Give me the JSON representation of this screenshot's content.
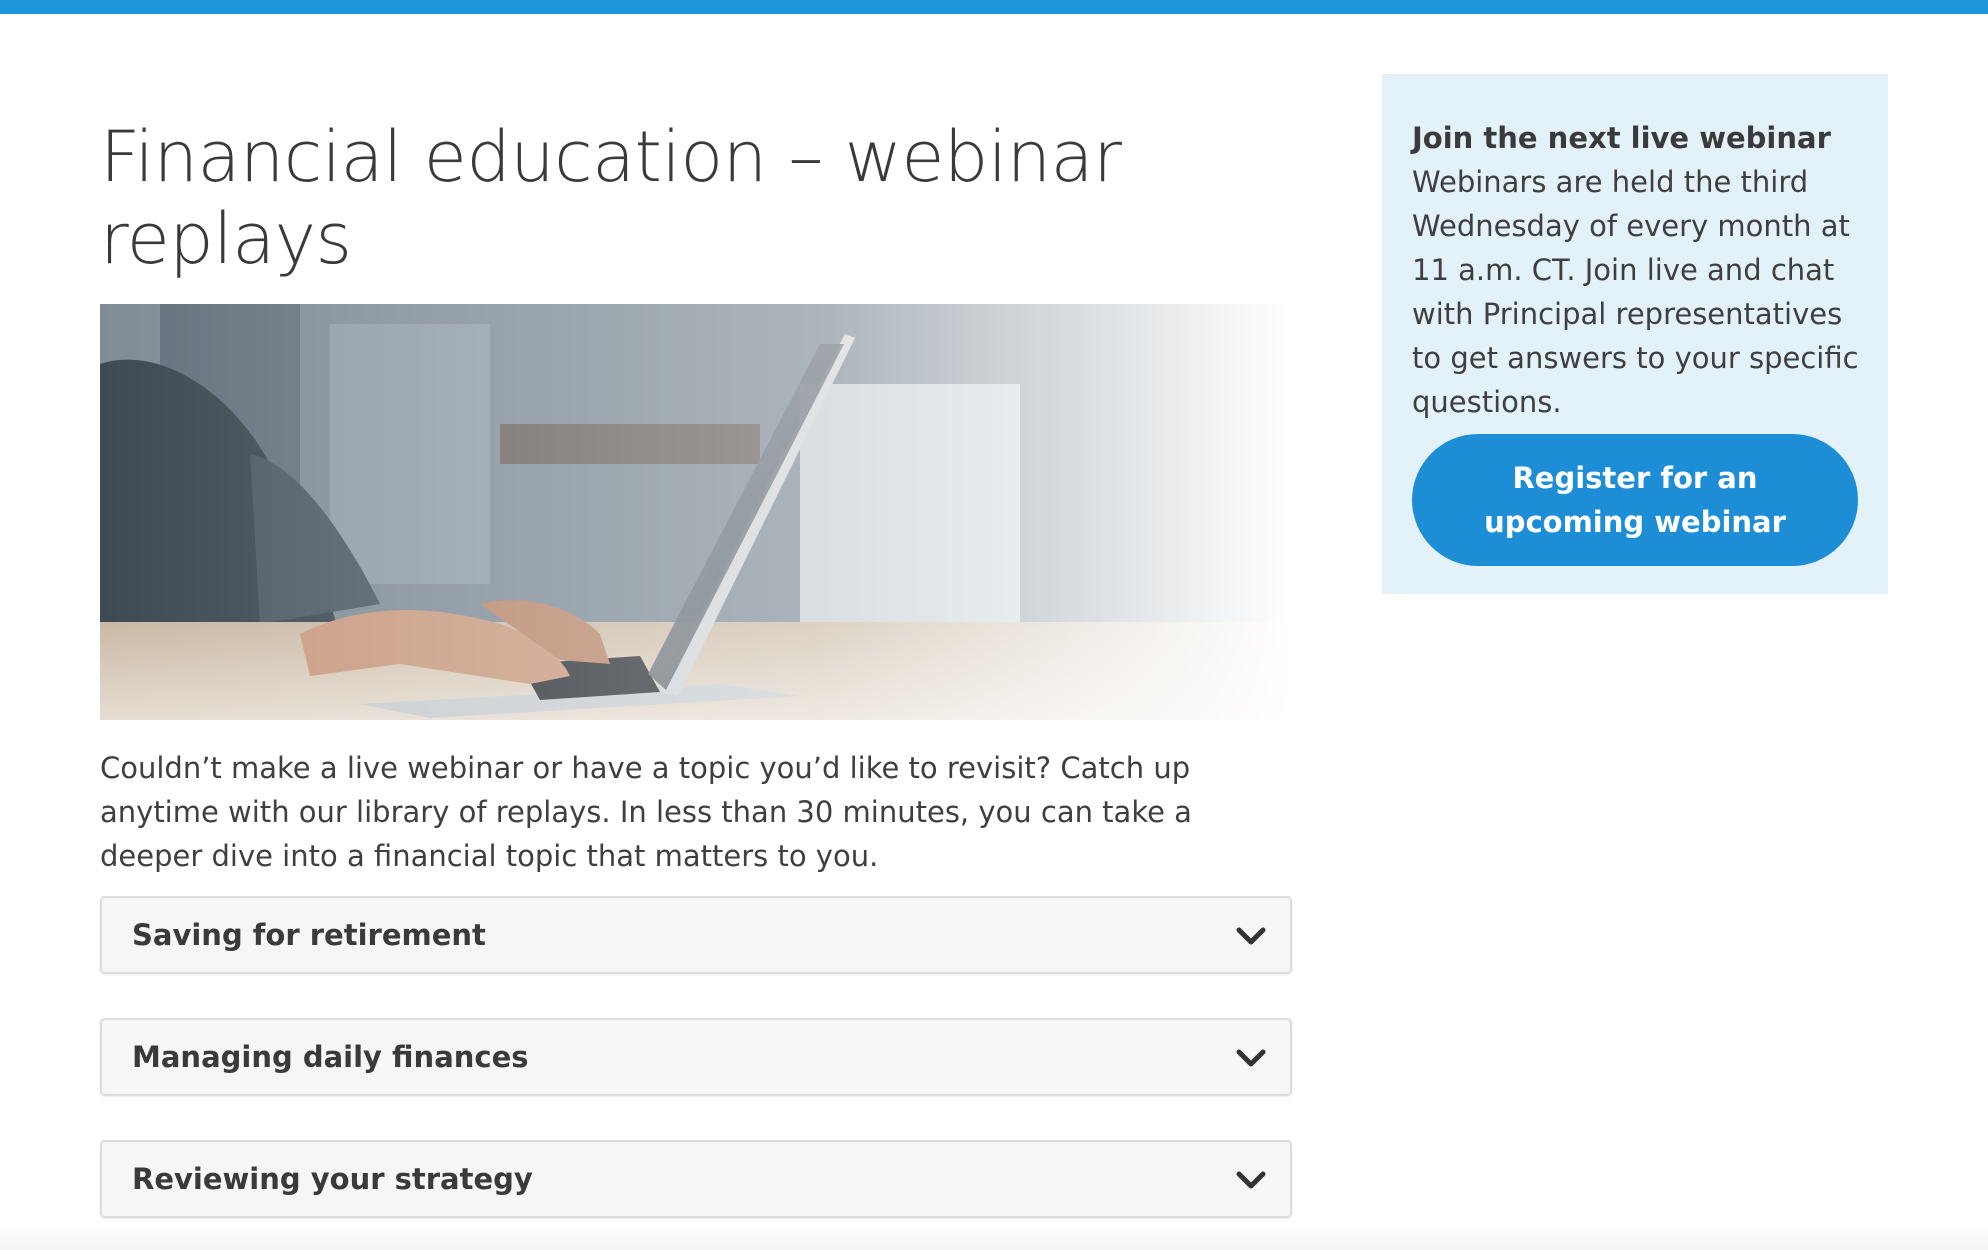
{
  "header": {
    "accent_color": "#1d95d8"
  },
  "main": {
    "title": "Financial education – webinar replays",
    "hero_image_alt": "Person typing on a laptop at a desk",
    "intro": "Couldn’t make a live webinar or have a topic you’d like to revisit? Catch up anytime with our library of replays. In less than 30 minutes, you can take a deeper dive into a financial topic that matters to you.",
    "accordions": [
      {
        "label": "Saving for retirement",
        "icon": "chevron-down-icon",
        "expanded": false
      },
      {
        "label": "Managing daily finances",
        "icon": "chevron-down-icon",
        "expanded": false
      },
      {
        "label": "Reviewing your strategy",
        "icon": "chevron-down-icon",
        "expanded": false
      }
    ]
  },
  "sidebar": {
    "heading": "Join the next live webinar",
    "body": "Webinars are held the third Wednesday of every month at 11 a.m. CT. Join live and chat with Principal representatives to get answers to your specific questions.",
    "button_label": "Register for an upcoming webinar",
    "card_color": "#e3f2f9",
    "button_color": "#1d8ed6"
  }
}
